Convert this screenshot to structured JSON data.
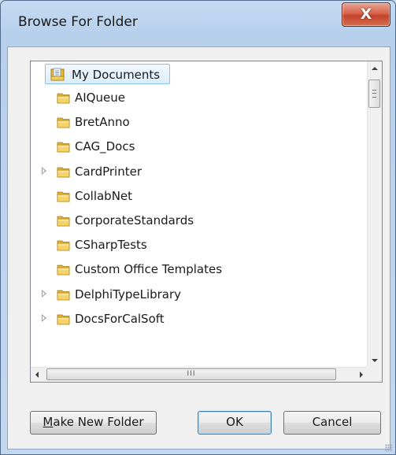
{
  "window": {
    "title": "Browse For Folder"
  },
  "titlebar": {
    "close_glyph": "X"
  },
  "tree": {
    "root": {
      "label": "My Documents",
      "icon": "documents-folder-icon",
      "selected": true
    },
    "items": [
      {
        "label": "AIQueue",
        "expandable": false
      },
      {
        "label": "BretAnno",
        "expandable": false
      },
      {
        "label": "CAG_Docs",
        "expandable": false
      },
      {
        "label": "CardPrinter",
        "expandable": true
      },
      {
        "label": "CollabNet",
        "expandable": false
      },
      {
        "label": "CorporateStandards",
        "expandable": false
      },
      {
        "label": "CSharpTests",
        "expandable": false
      },
      {
        "label": "Custom Office Templates",
        "expandable": false
      },
      {
        "label": "DelphiTypeLibrary",
        "expandable": true
      },
      {
        "label": "DocsForCalSoft",
        "expandable": true
      }
    ],
    "hscroll_grip": "III"
  },
  "buttons": {
    "make_new_folder": {
      "underline": "M",
      "rest": "ake New Folder"
    },
    "ok": "OK",
    "cancel": "Cancel"
  },
  "colors": {
    "frame": "#c3d8ef",
    "close_button": "#c8452c",
    "selection": "#dbeefb",
    "folder": "#f2c94c"
  }
}
